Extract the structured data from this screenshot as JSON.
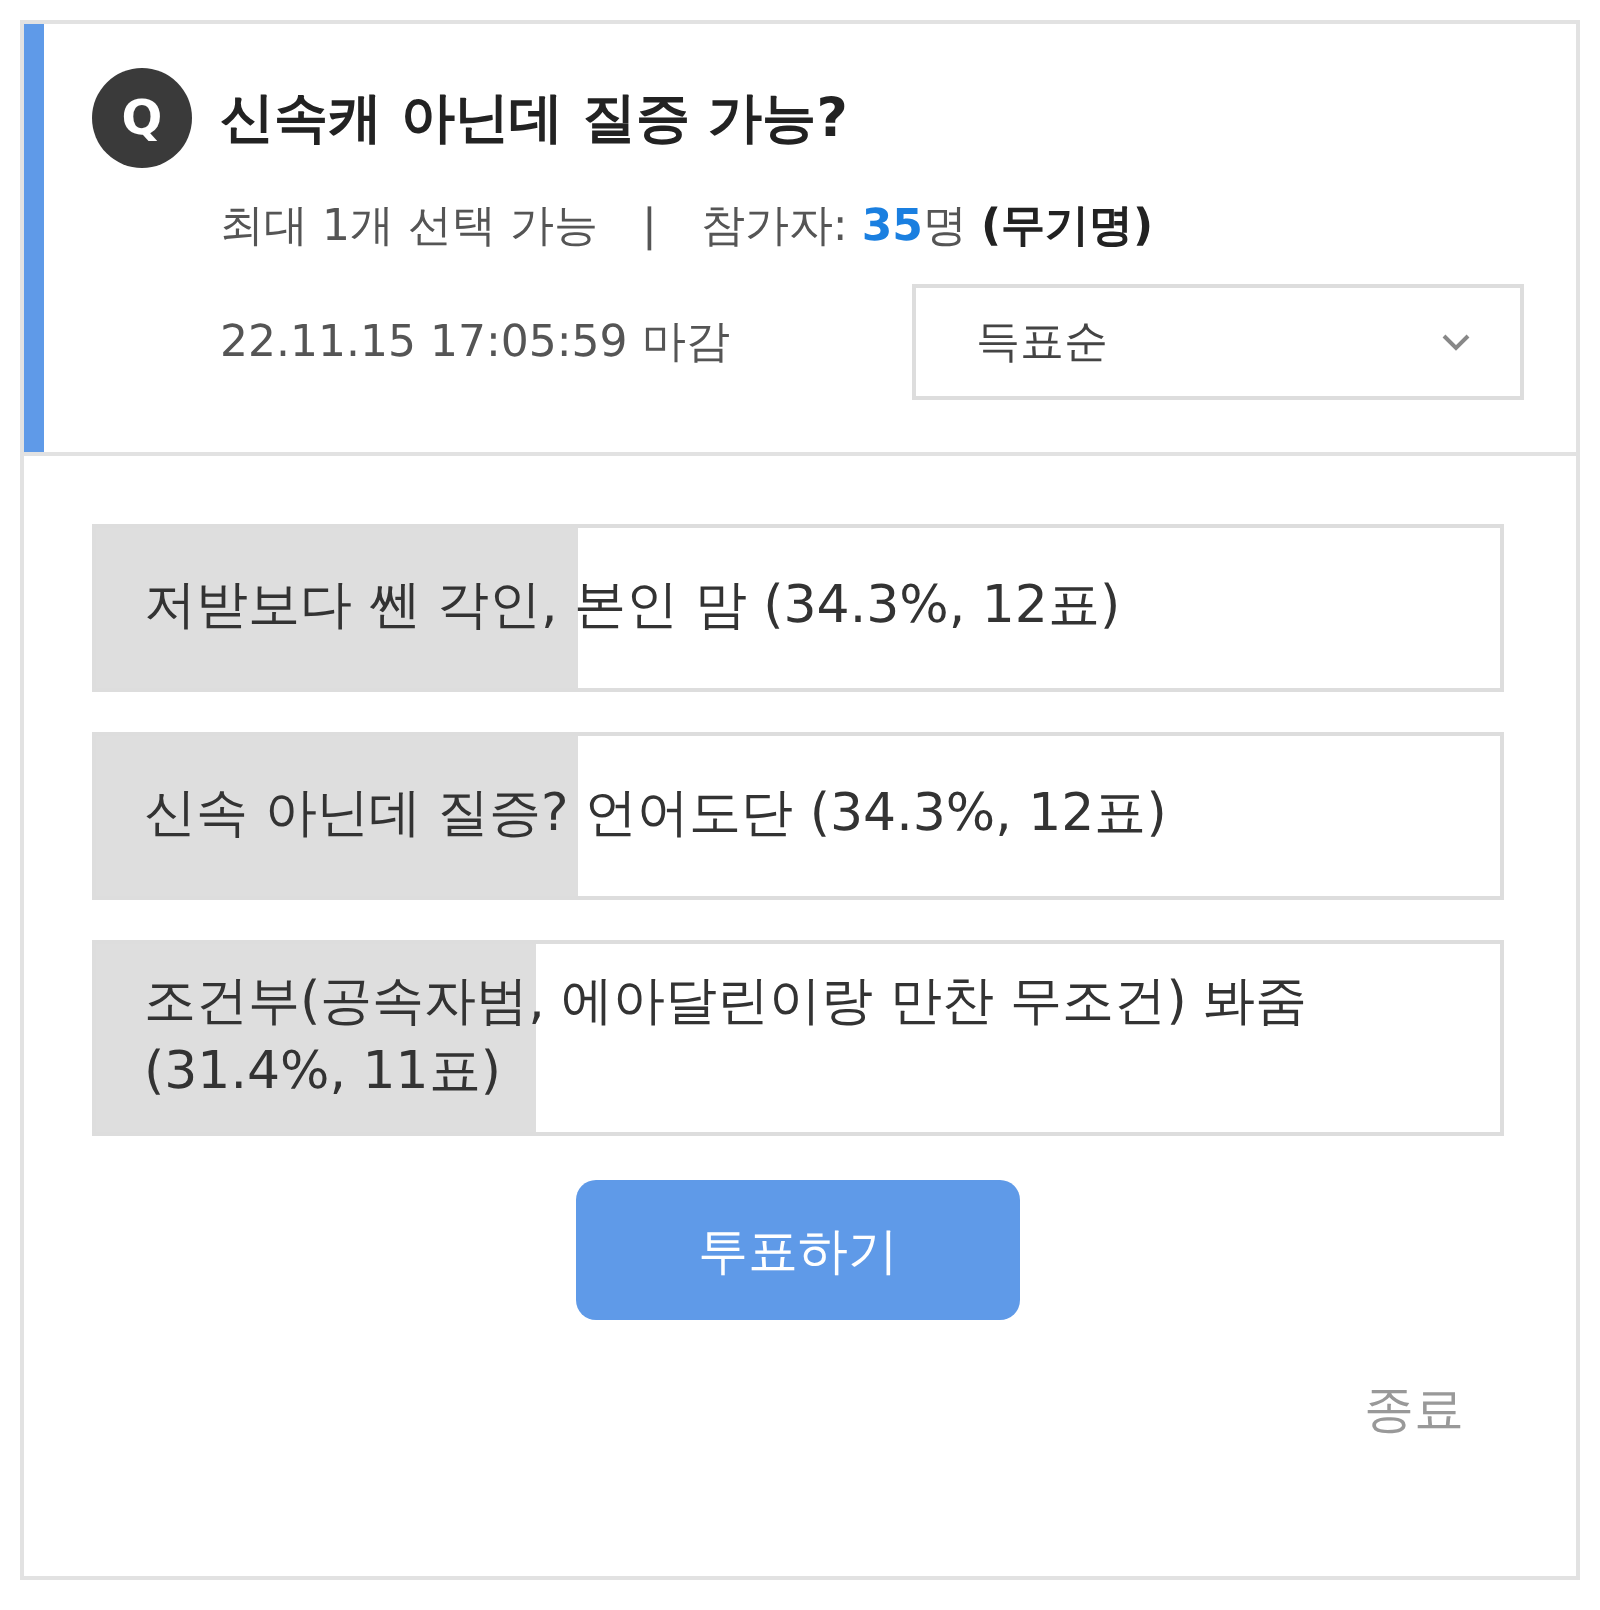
{
  "question": {
    "badge": "Q",
    "title": "신속캐 아닌데 질증 가능?"
  },
  "meta": {
    "limit": "최대 1개 선택 가능",
    "separator": "|",
    "participants_label": "참가자:",
    "participants_count": "35",
    "participants_unit": "명",
    "anonymous": "(무기명)"
  },
  "deadline": "22.11.15 17:05:59 마감",
  "sort_select": {
    "value": "득표순"
  },
  "options": [
    {
      "text": "저받보다 쎈 각인, 본인 맘 (34.3%, 12표)",
      "level": 0.343
    },
    {
      "text": "신속 아닌데 질증? 언어도단 (34.3%, 12표)",
      "level": 0.343
    },
    {
      "text": "조건부(공속자범, 에아달린이랑 만찬 무조건) 봐줌 (31.4%, 11표)",
      "level": 0.314
    }
  ],
  "vote_button": "투표하기",
  "end_link": "종료"
}
